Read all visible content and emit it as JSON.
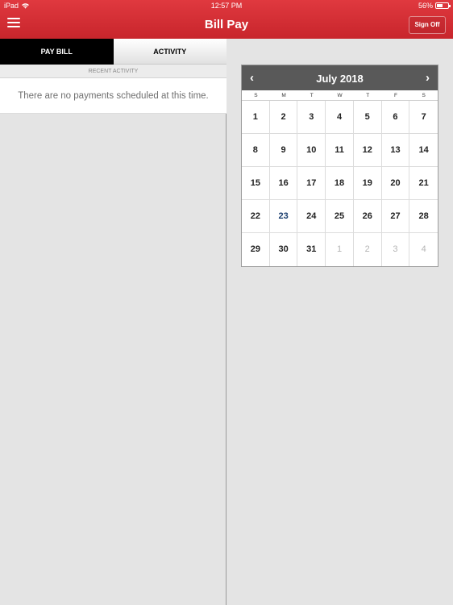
{
  "status_bar": {
    "device": "iPad",
    "time": "12:57 PM",
    "battery": "56%",
    "battery_level": 0.56
  },
  "header": {
    "title": "Bill Pay",
    "sign_off_label": "Sign Off"
  },
  "tabs": [
    {
      "label": "PAY BILL",
      "selected": false
    },
    {
      "label": "ACTIVITY",
      "selected": true
    }
  ],
  "activity": {
    "section_label": "RECENT ACTIVITY",
    "empty_message": "There are no payments scheduled at this time."
  },
  "calendar": {
    "month_title": "July 2018",
    "prev_icon": "chevron-left-icon",
    "next_icon": "chevron-right-icon",
    "weekdays": [
      "S",
      "M",
      "T",
      "W",
      "T",
      "F",
      "S"
    ],
    "weeks": [
      [
        "1",
        "2",
        "3",
        "4",
        "5",
        "6",
        "7"
      ],
      [
        "8",
        "9",
        "10",
        "11",
        "12",
        "13",
        "14"
      ],
      [
        "15",
        "16",
        "17",
        "18",
        "19",
        "20",
        "21"
      ],
      [
        "22",
        "23",
        "24",
        "25",
        "26",
        "27",
        "28"
      ],
      [
        "29",
        "30",
        "31",
        "1",
        "2",
        "3",
        "4"
      ]
    ],
    "highlighted_day": "23",
    "colors": {
      "header": "#595959",
      "today": "#1a3e6e",
      "out_of_month": "#b5b5b5"
    }
  },
  "colors": {
    "brand": "#d12f35",
    "tab_selected": "#000000"
  }
}
